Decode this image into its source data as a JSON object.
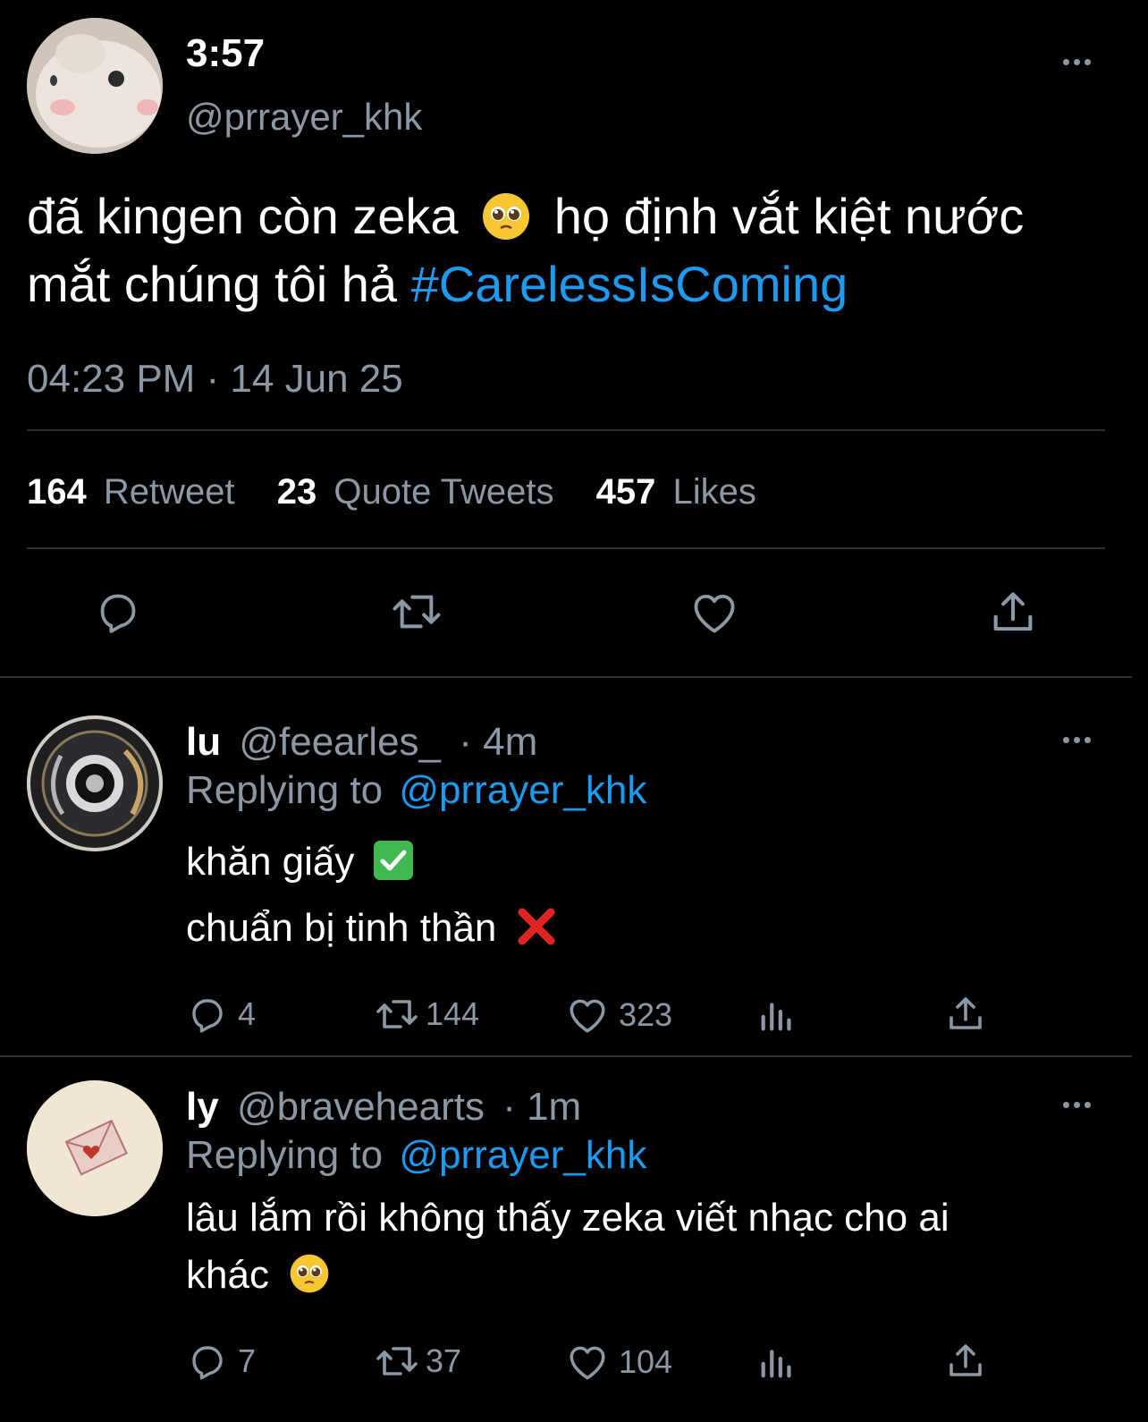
{
  "main_tweet": {
    "display_name": "3:57",
    "handle": "@prrayer_khk",
    "text_part1": "đã kingen còn zeka",
    "text_part2": "họ định vắt kiệt nước mắt chúng tôi hả",
    "hashtag": "#CarelessIsComing",
    "timestamp": "04:23 PM · 14 Jun 25",
    "stats": {
      "retweet_count": "164",
      "retweet_label": "Retweet",
      "quote_count": "23",
      "quote_label": "Quote Tweets",
      "likes_count": "457",
      "likes_label": "Likes"
    }
  },
  "replies": [
    {
      "display_name": "lu",
      "handle": "@feearles_",
      "time": "· 4m",
      "replying_prefix": "Replying to",
      "replying_handle": "@prrayer_khk",
      "line1": "khăn giấy",
      "line2": "chuẩn bị tinh thần",
      "replies": "4",
      "retweets": "144",
      "likes": "323"
    },
    {
      "display_name": "ly",
      "handle": "@bravehearts",
      "time": "· 1m",
      "replying_prefix": "Replying to",
      "replying_handle": "@prrayer_khk",
      "line1": "lâu lắm rồi không thấy zeka viết nhạc cho ai",
      "line2": "khác",
      "replies": "7",
      "retweets": "37",
      "likes": "104"
    }
  ],
  "colors": {
    "background": "#000000",
    "text": "#ffffff",
    "secondary": "#8b98a5",
    "accent": "#1d9bf0",
    "divider": "#2a2f33"
  }
}
